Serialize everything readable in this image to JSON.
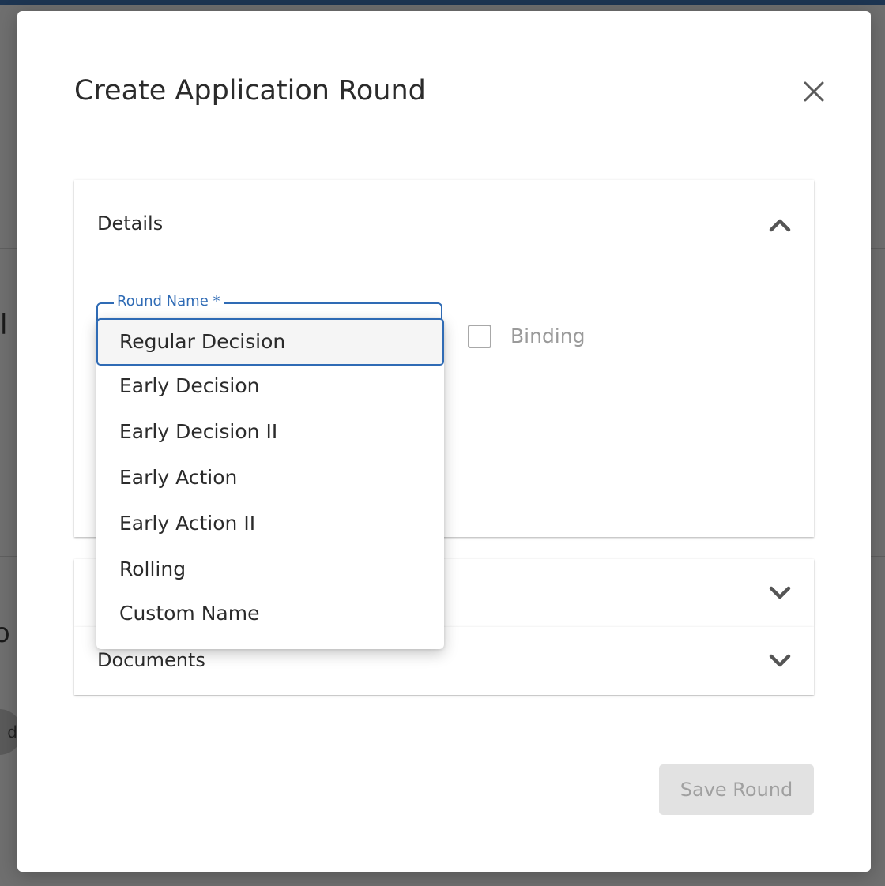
{
  "modal": {
    "title": "Create Application Round"
  },
  "sections": {
    "details": {
      "label": "Details",
      "expanded": true
    },
    "second": {
      "label": "",
      "expanded": false
    },
    "documents": {
      "label": "Documents",
      "expanded": false
    }
  },
  "round_name_field": {
    "label": "Round Name *",
    "selected_value": "Regular Decision",
    "options": [
      "Regular Decision",
      "Early Decision",
      "Early Decision II",
      "Early Action",
      "Early Action II",
      "Rolling",
      "Custom Name"
    ]
  },
  "binding_checkbox": {
    "label": "Binding",
    "checked": false
  },
  "actions": {
    "save_label": "Save Round"
  },
  "backdrop": {
    "fragment_1": "l",
    "fragment_2": "o",
    "fragment_3": "d"
  },
  "icons": {
    "close": "close-icon",
    "expand": "chevron-down-icon",
    "collapse": "chevron-up-icon"
  },
  "colors": {
    "accent": "#2f6bb5",
    "backdrop": "#6f6f6f",
    "disabled_button": "#e2e2e2"
  }
}
